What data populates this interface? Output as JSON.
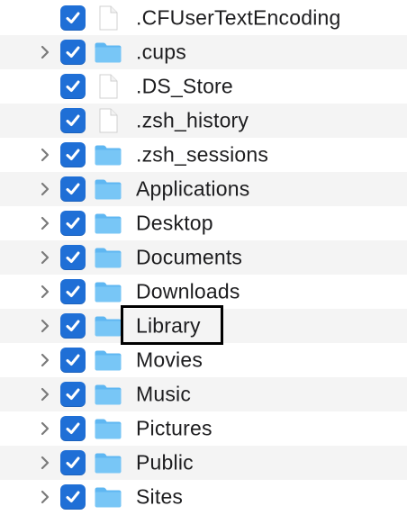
{
  "colors": {
    "checkbox_fill": "#1f6fd6",
    "folder_color": "#5fb7f2",
    "row_alt_bg": "#f4f4f4",
    "text": "#1d1d1f"
  },
  "items": [
    {
      "name": ".CFUserTextEncoding",
      "type": "file",
      "expandable": false,
      "checked": true,
      "icon": "document-icon"
    },
    {
      "name": ".cups",
      "type": "folder",
      "expandable": true,
      "checked": true,
      "icon": "folder-icon"
    },
    {
      "name": ".DS_Store",
      "type": "file",
      "expandable": false,
      "checked": true,
      "icon": "document-icon"
    },
    {
      "name": ".zsh_history",
      "type": "file",
      "expandable": false,
      "checked": true,
      "icon": "document-icon"
    },
    {
      "name": ".zsh_sessions",
      "type": "folder",
      "expandable": true,
      "checked": true,
      "icon": "folder-icon"
    },
    {
      "name": "Applications",
      "type": "folder",
      "expandable": true,
      "checked": true,
      "icon": "folder-icon"
    },
    {
      "name": "Desktop",
      "type": "folder",
      "expandable": true,
      "checked": true,
      "icon": "folder-icon"
    },
    {
      "name": "Documents",
      "type": "folder",
      "expandable": true,
      "checked": true,
      "icon": "folder-icon"
    },
    {
      "name": "Downloads",
      "type": "folder",
      "expandable": true,
      "checked": true,
      "icon": "folder-icon"
    },
    {
      "name": "Library",
      "type": "folder",
      "expandable": true,
      "checked": true,
      "icon": "folder-icon",
      "highlighted": true
    },
    {
      "name": "Movies",
      "type": "folder",
      "expandable": true,
      "checked": true,
      "icon": "folder-icon"
    },
    {
      "name": "Music",
      "type": "folder",
      "expandable": true,
      "checked": true,
      "icon": "folder-icon"
    },
    {
      "name": "Pictures",
      "type": "folder",
      "expandable": true,
      "checked": true,
      "icon": "folder-icon"
    },
    {
      "name": "Public",
      "type": "folder",
      "expandable": true,
      "checked": true,
      "icon": "folder-icon"
    },
    {
      "name": "Sites",
      "type": "folder",
      "expandable": true,
      "checked": true,
      "icon": "folder-icon"
    }
  ]
}
